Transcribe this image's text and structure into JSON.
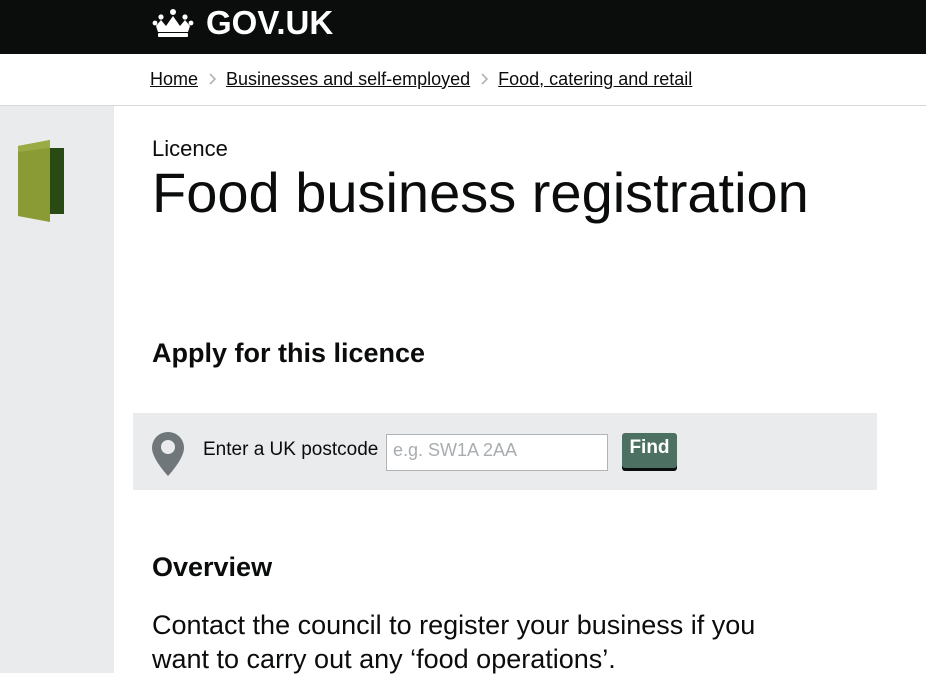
{
  "header": {
    "logo_text": "GOV.UK",
    "crown_icon": "crown-icon",
    "background_color": "#0b0c0c"
  },
  "breadcrumbs": [
    {
      "label": "Home"
    },
    {
      "label": "Businesses and self-employed"
    },
    {
      "label": "Food, catering and retail"
    }
  ],
  "sidebar": {
    "icon": "licence-book-icon",
    "background_color": "#e9ebec"
  },
  "page": {
    "caption": "Licence",
    "title": "Food business registration"
  },
  "apply": {
    "heading": "Apply for this licence",
    "postcode_label": "Enter a UK postcode",
    "postcode_placeholder": "e.g. SW1A 2AA",
    "postcode_value": "",
    "find_label": "Find",
    "pin_icon": "location-pin-icon",
    "button_color": "#4c7163"
  },
  "overview": {
    "heading": "Overview",
    "text": "Contact the council to register your business if you want to carry out any ‘food operations’."
  }
}
